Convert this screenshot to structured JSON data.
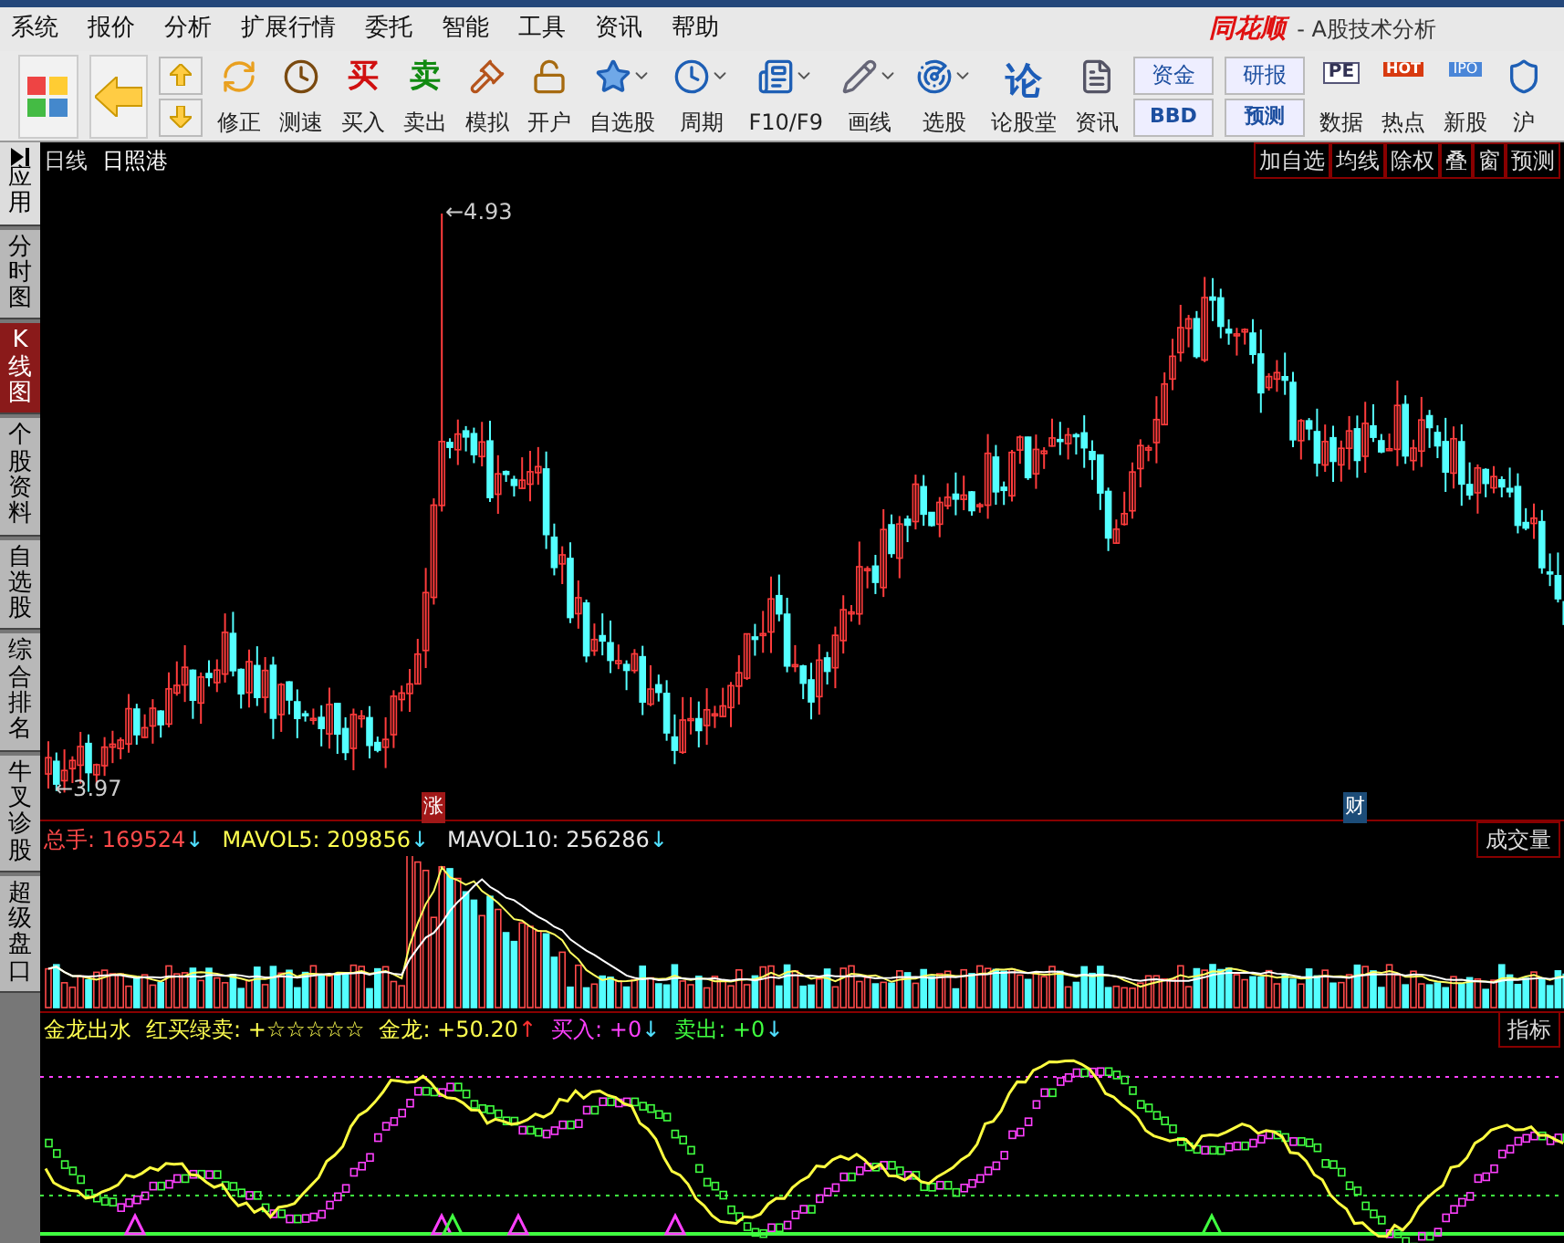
{
  "title_bar": {
    "logo": "同花顺",
    "title": "- A股技术分析"
  },
  "menu": [
    "系统",
    "报价",
    "分析",
    "扩展行情",
    "委托",
    "智能",
    "工具",
    "资讯",
    "帮助"
  ],
  "toolbar": [
    {
      "kind": "tile"
    },
    {
      "kind": "tile"
    },
    {
      "kind": "updown"
    },
    {
      "kind": "icon",
      "label": "修正",
      "dropdown": false
    },
    {
      "kind": "icon",
      "label": "测速",
      "dropdown": false
    },
    {
      "kind": "glyph",
      "glyph": "买",
      "label": "买入"
    },
    {
      "kind": "glyph",
      "glyph": "卖",
      "label": "卖出"
    },
    {
      "kind": "icon",
      "label": "模拟",
      "dropdown": false
    },
    {
      "kind": "icon",
      "label": "开户",
      "dropdown": false
    },
    {
      "kind": "icon",
      "label": "自选股",
      "dropdown": true
    },
    {
      "kind": "icon",
      "label": "周期",
      "dropdown": true
    },
    {
      "kind": "icon",
      "label": "F10/F9",
      "dropdown": true
    },
    {
      "kind": "icon",
      "label": "画线",
      "dropdown": true
    },
    {
      "kind": "icon",
      "label": "选股",
      "dropdown": true
    },
    {
      "kind": "glyph",
      "glyph": "论",
      "label": "论股堂"
    },
    {
      "kind": "icon",
      "label": "资讯",
      "dropdown": false
    },
    {
      "kind": "pair",
      "top": "资金",
      "bottom": "BBD"
    },
    {
      "kind": "pair",
      "top": "研报",
      "bottom": "预测"
    },
    {
      "kind": "glyph",
      "glyph": "PE",
      "label": "数据"
    },
    {
      "kind": "glyph",
      "glyph": "HOT",
      "label": "热点"
    },
    {
      "kind": "glyph",
      "glyph": "IPO",
      "label": "新股"
    },
    {
      "kind": "icon",
      "label": "沪",
      "dropdown": false
    }
  ],
  "sidebar": [
    {
      "label": "应用",
      "selected": false,
      "play": true
    },
    {
      "label": "分时图",
      "selected": false,
      "play": false
    },
    {
      "label": "K线图",
      "selected": true,
      "play": false
    },
    {
      "label": "个股资料",
      "selected": false,
      "play": false
    },
    {
      "label": "自选股",
      "selected": false,
      "play": false
    },
    {
      "label": "综合排名",
      "selected": false,
      "play": false
    },
    {
      "label": "牛叉诊股",
      "selected": false,
      "play": false
    },
    {
      "label": "超级盘口",
      "selected": false,
      "play": false
    }
  ],
  "main_chart": {
    "period": "日线",
    "stock": "日照港",
    "buttons": [
      "加自选",
      "均线",
      "除权",
      "叠",
      "窗",
      "预测"
    ],
    "high_label": "←4.93",
    "low_label": "←3.97",
    "markers": [
      {
        "text": "涨",
        "kind": "rise"
      },
      {
        "text": "财",
        "kind": "finance"
      }
    ]
  },
  "volume_panel": {
    "name": "成交量",
    "readings": [
      {
        "label": "总手: 169524",
        "arrow": "↓"
      },
      {
        "label": "MAVOL5: 209856",
        "arrow": "↓"
      },
      {
        "label": "MAVOL10: 256286",
        "arrow": "↓"
      }
    ]
  },
  "indicator_panel": {
    "name": "指标",
    "readings": [
      {
        "label": "金龙出水"
      },
      {
        "label": "红买绿卖: +☆☆☆☆☆"
      },
      {
        "label": "金龙: +50.20",
        "arrow": "↑"
      },
      {
        "label": "买入: +0",
        "arrow": "↓"
      },
      {
        "label": "卖出: +0",
        "arrow": "↓"
      }
    ]
  }
}
